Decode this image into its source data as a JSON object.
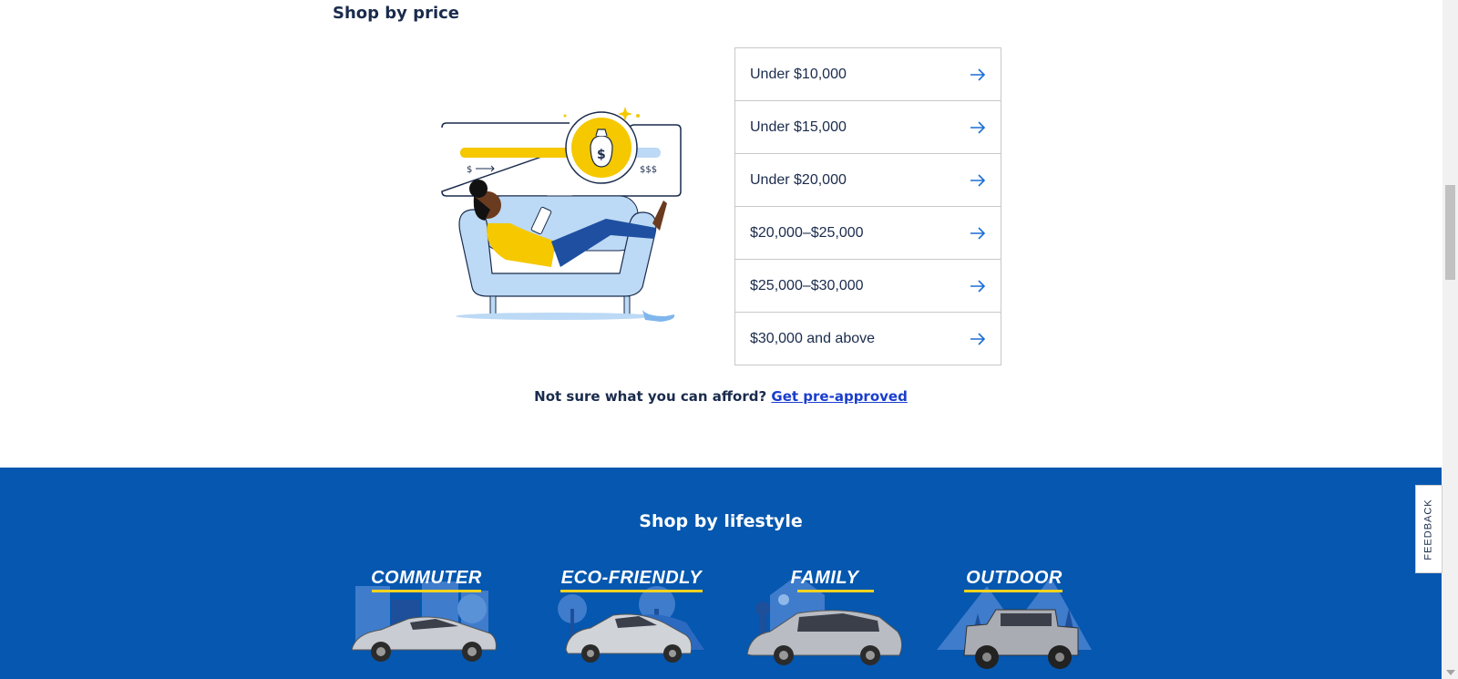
{
  "price_section": {
    "title": "Shop by price",
    "illustration": {
      "low_label": "$",
      "high_label": "$$$",
      "coin_symbol": "$",
      "colors": {
        "yellow": "#f5c800",
        "light_blue": "#bcd9f5",
        "navy": "#1a2b4c"
      }
    },
    "options": [
      {
        "label": "Under $10,000",
        "icon": "arrow-right-icon"
      },
      {
        "label": "Under $15,000",
        "icon": "arrow-right-icon"
      },
      {
        "label": "Under $20,000",
        "icon": "arrow-right-icon"
      },
      {
        "label": "$20,000–$25,000",
        "icon": "arrow-right-icon"
      },
      {
        "label": "$25,000–$30,000",
        "icon": "arrow-right-icon"
      },
      {
        "label": "$30,000 and above",
        "icon": "arrow-right-icon"
      }
    ],
    "afford_text": "Not sure what you can afford?",
    "afford_link": "Get pre-approved"
  },
  "lifestyle_section": {
    "title": "Shop by lifestyle",
    "background_color": "#0557af",
    "accent_color": "#f4d21f",
    "tiles": [
      {
        "label": "COMMUTER"
      },
      {
        "label": "ECO-FRIENDLY"
      },
      {
        "label": "FAMILY"
      },
      {
        "label": "OUTDOOR"
      }
    ]
  },
  "feedback": {
    "label": "FEEDBACK"
  }
}
